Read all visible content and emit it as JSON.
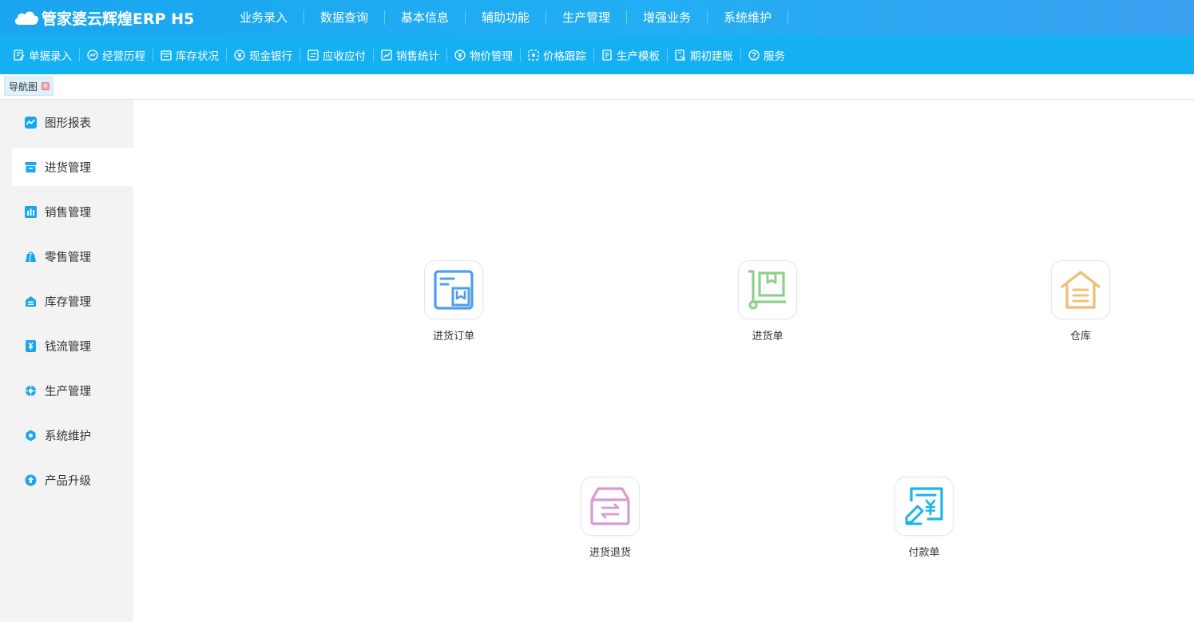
{
  "app": {
    "logo_text": "管家婆云辉煌ERP H5"
  },
  "top_nav": [
    "业务录入",
    "数据查询",
    "基本信息",
    "辅助功能",
    "生产管理",
    "增强业务",
    "系统维护"
  ],
  "toolbar": [
    {
      "label": "单据录入",
      "icon": "edit-doc-icon"
    },
    {
      "label": "经营历程",
      "icon": "trend-circle-icon"
    },
    {
      "label": "库存状况",
      "icon": "calendar-box-icon"
    },
    {
      "label": "现金银行",
      "icon": "yuan-circle-icon"
    },
    {
      "label": "应收应付",
      "icon": "exchange-box-icon"
    },
    {
      "label": "销售统计",
      "icon": "chart-box-icon"
    },
    {
      "label": "物价管理",
      "icon": "yuan-circle-icon"
    },
    {
      "label": "价格跟踪",
      "icon": "target-box-icon"
    },
    {
      "label": "生产模板",
      "icon": "document-icon"
    },
    {
      "label": "期初建账",
      "icon": "account-book-icon"
    },
    {
      "label": "服务",
      "icon": "help-circle-icon"
    }
  ],
  "tabs": [
    {
      "label": "导航图"
    }
  ],
  "sidebar": [
    {
      "label": "图形报表",
      "icon": "line-chart-icon",
      "active": false
    },
    {
      "label": "进货管理",
      "icon": "archive-box-icon",
      "active": true
    },
    {
      "label": "销售管理",
      "icon": "bar-chart-icon",
      "active": false
    },
    {
      "label": "零售管理",
      "icon": "shopping-bag-icon",
      "active": false
    },
    {
      "label": "库存管理",
      "icon": "warehouse-icon",
      "active": false
    },
    {
      "label": "钱流管理",
      "icon": "yuan-box-icon",
      "active": false
    },
    {
      "label": "生产管理",
      "icon": "gear-icon",
      "active": false
    },
    {
      "label": "系统维护",
      "icon": "hexagon-gear-icon",
      "active": false
    },
    {
      "label": "产品升级",
      "icon": "upgrade-icon",
      "active": false
    }
  ],
  "tiles": [
    {
      "label": "进货订单",
      "icon": "purchase-order-icon",
      "color": "#4f9cf0"
    },
    {
      "label": "进货单",
      "icon": "cart-box-icon",
      "color": "#8fce8b"
    },
    {
      "label": "仓库",
      "icon": "warehouse-house-icon",
      "color": "#ecc17a"
    },
    {
      "label": "进货退货",
      "icon": "return-box-icon",
      "color": "#d79ad6"
    },
    {
      "label": "付款单",
      "icon": "payment-doc-icon",
      "color": "#19b4ec"
    }
  ],
  "colors": {
    "header_bg": "#1aa6ef",
    "toolbar_bg": "#15b0f1",
    "sidebar_bg": "#f3f3f3",
    "side_icon": "#1aa6ef"
  }
}
